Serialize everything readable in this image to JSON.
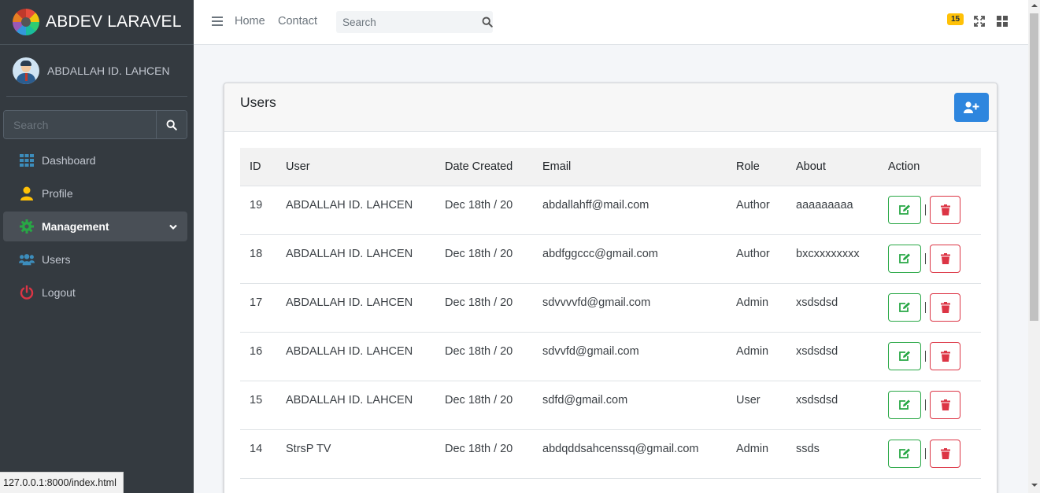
{
  "brand": {
    "name": "ABDEV LARAVEL"
  },
  "user": {
    "name": "ABDALLAH ID. LAHCEN"
  },
  "sidebar": {
    "search_placeholder": "Search",
    "items": [
      {
        "label": "Dashboard",
        "icon": "th-icon",
        "color": "#3c8dbc"
      },
      {
        "label": "Profile",
        "icon": "user-icon",
        "color": "#ffc107"
      },
      {
        "label": "Management",
        "icon": "cog-icon",
        "color": "#28a745",
        "active": true
      },
      {
        "label": "Users",
        "icon": "users-icon",
        "color": "#3c8dbc"
      },
      {
        "label": "Logout",
        "icon": "power-icon",
        "color": "#dc3545"
      }
    ]
  },
  "topbar": {
    "links": [
      "Home",
      "Contact"
    ],
    "search_placeholder": "Search",
    "badge": "15"
  },
  "card": {
    "title": "Users",
    "columns": [
      "ID",
      "User",
      "Date Created",
      "Email",
      "Role",
      "About",
      "Action"
    ],
    "rows": [
      {
        "id": "19",
        "user": "ABDALLAH ID. LAHCEN",
        "date": "Dec 18th / 20",
        "email": "abdallahff@mail.com",
        "role": "Author",
        "about": "aaaaaaaaa"
      },
      {
        "id": "18",
        "user": "ABDALLAH ID. LAHCEN",
        "date": "Dec 18th / 20",
        "email": "abdfggccc@gmail.com",
        "role": "Author",
        "about": "bxcxxxxxxxx"
      },
      {
        "id": "17",
        "user": "ABDALLAH ID. LAHCEN",
        "date": "Dec 18th / 20",
        "email": "sdvvvvfd@gmail.com",
        "role": "Admin",
        "about": "xsdsdsd"
      },
      {
        "id": "16",
        "user": "ABDALLAH ID. LAHCEN",
        "date": "Dec 18th / 20",
        "email": "sdvvfd@gmail.com",
        "role": "Admin",
        "about": "xsdsdsd"
      },
      {
        "id": "15",
        "user": "ABDALLAH ID. LAHCEN",
        "date": "Dec 18th / 20",
        "email": "sdfd@gmail.com",
        "role": "User",
        "about": "xsdsdsd"
      },
      {
        "id": "14",
        "user": "StrsP TV",
        "date": "Dec 18th / 20",
        "email": "abdqddsahcenssq@gmail.com",
        "role": "Admin",
        "about": "ssds"
      }
    ]
  },
  "statusbar": {
    "url": "127.0.0.1:8000/index.html"
  }
}
